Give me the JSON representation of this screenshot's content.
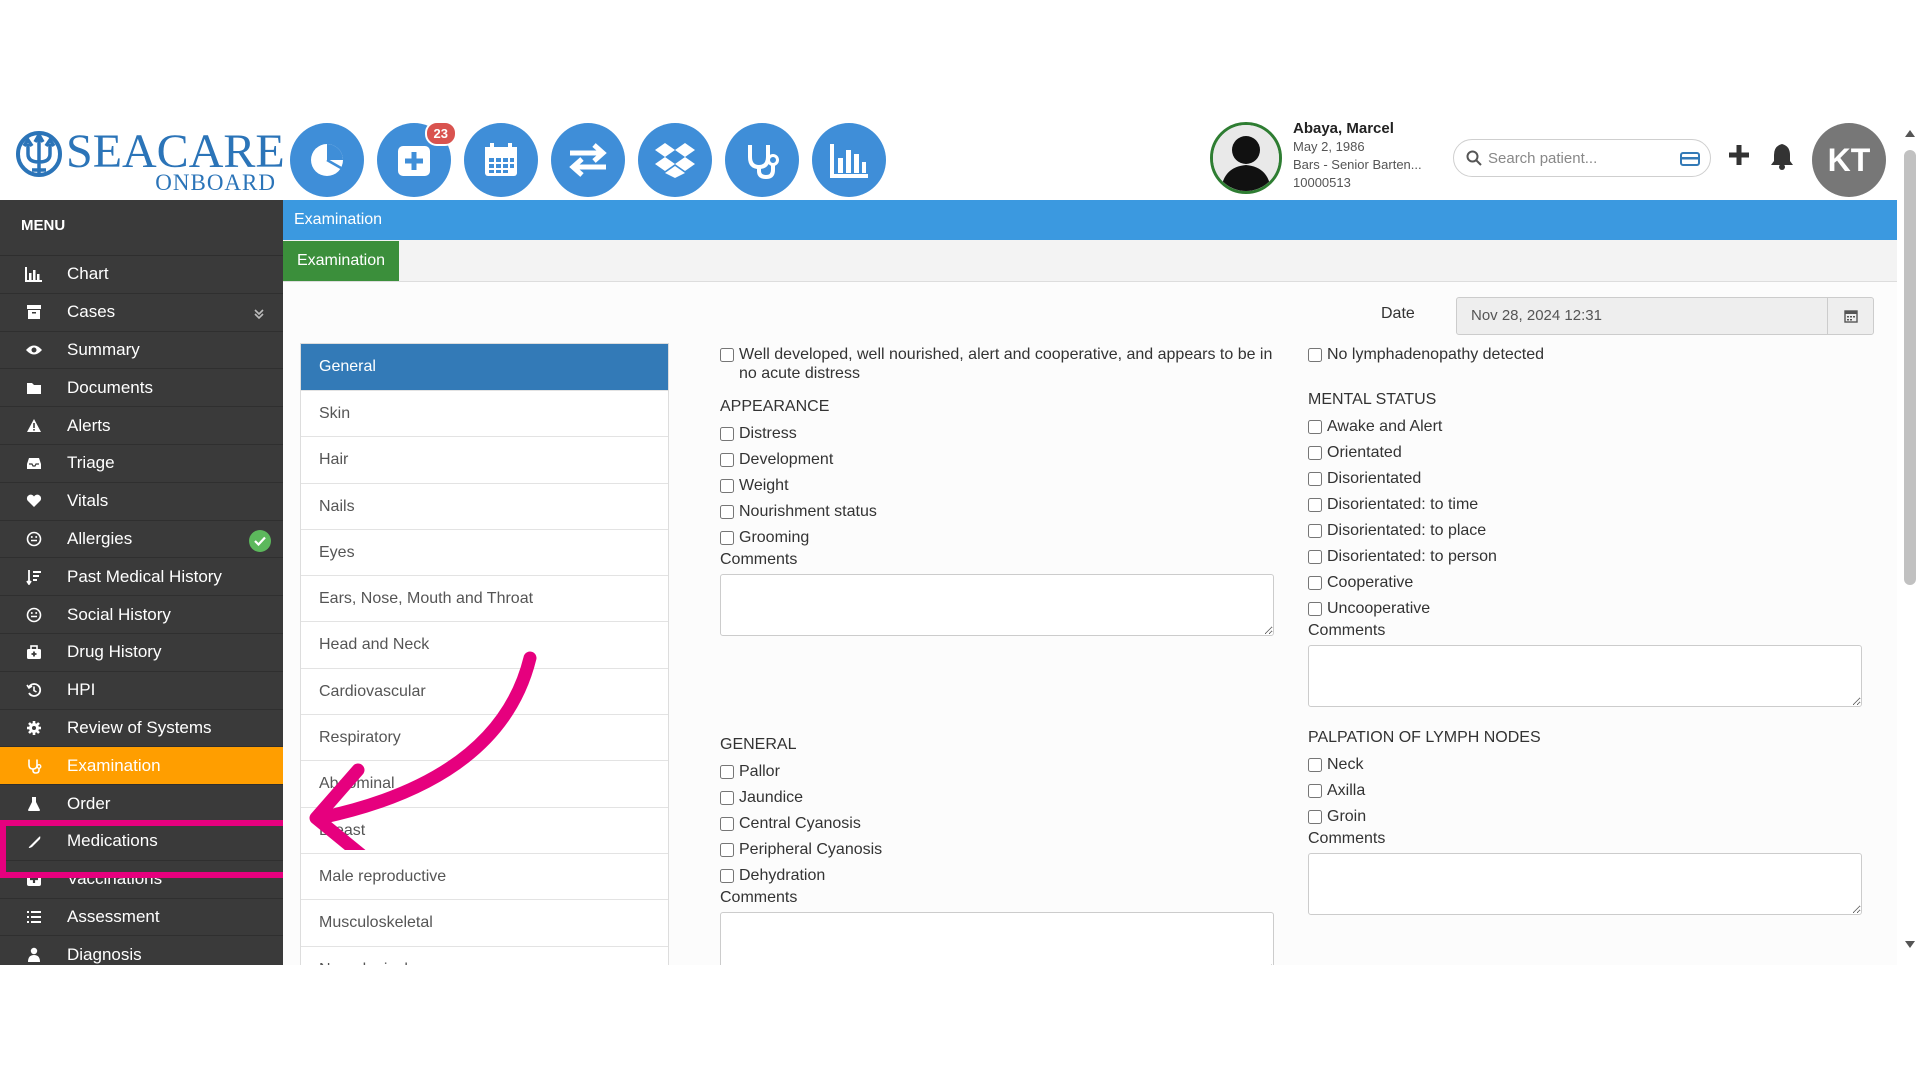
{
  "brand": {
    "name": "SEACARE",
    "sub": "ONBOARD",
    "color": "#2b74b8"
  },
  "toolbar": {
    "icons": [
      "dashboard-icon",
      "add-case-icon",
      "calendar-icon",
      "transfer-icon",
      "dropbox-icon",
      "stethoscope-icon",
      "bar-chart-icon"
    ],
    "add_case_badge": "23",
    "accent": "#3f8ed8"
  },
  "patient": {
    "name": "Abaya, Marcel",
    "dob": "May 2, 1986",
    "position": "Bars - Senior Barten...",
    "id": "10000513"
  },
  "search": {
    "placeholder": "Search patient..."
  },
  "user": {
    "initials": "KT"
  },
  "sidebar": {
    "menu_label": "MENU",
    "items": [
      {
        "label": "Chart",
        "icon": "bar-chart-icon"
      },
      {
        "label": "Cases",
        "icon": "archive-icon"
      },
      {
        "label": "Summary",
        "icon": "eye-icon"
      },
      {
        "label": "Documents",
        "icon": "folder-icon"
      },
      {
        "label": "Alerts",
        "icon": "warning-icon"
      },
      {
        "label": "Triage",
        "icon": "inbox-icon"
      },
      {
        "label": "Vitals",
        "icon": "heart-icon"
      },
      {
        "label": "Allergies",
        "icon": "face-icon"
      },
      {
        "label": "Past Medical History",
        "icon": "sort-icon"
      },
      {
        "label": "Social History",
        "icon": "face-icon"
      },
      {
        "label": "Drug History",
        "icon": "medkit-icon"
      },
      {
        "label": "HPI",
        "icon": "history-icon"
      },
      {
        "label": "Review of Systems",
        "icon": "gear-icon"
      },
      {
        "label": "Examination",
        "icon": "stethoscope-icon"
      },
      {
        "label": "Order",
        "icon": "flask-icon"
      },
      {
        "label": "Medications",
        "icon": "pill-icon"
      },
      {
        "label": "Vaccinations",
        "icon": "plus-square-icon"
      },
      {
        "label": "Assessment",
        "icon": "list-icon"
      },
      {
        "label": "Diagnosis",
        "icon": "doctor-icon"
      }
    ],
    "active": "Examination",
    "active_color": "#ff9e00"
  },
  "main": {
    "title": "Examination",
    "subtab": "Examination",
    "date_label": "Date",
    "date_value": "Nov 28, 2024 12:31",
    "sections": [
      "General",
      "Skin",
      "Hair",
      "Nails",
      "Eyes",
      "Ears, Nose, Mouth and Throat",
      "Head and Neck",
      "Cardiovascular",
      "Respiratory",
      "Abdominal",
      "Breast",
      "Male reproductive",
      "Musculoskeletal",
      "Neurological"
    ],
    "active_section": "General",
    "left": {
      "top_check": "Well developed, well nourished, alert and cooperative, and appears to be in no acute distress",
      "appearance_head": "APPEARANCE",
      "appearance": [
        "Distress",
        "Development",
        "Weight",
        "Nourishment status",
        "Grooming"
      ],
      "general_head": "GENERAL",
      "general": [
        "Pallor",
        "Jaundice",
        "Central Cyanosis",
        "Peripheral Cyanosis",
        "Dehydration"
      ],
      "comments_label": "Comments"
    },
    "right": {
      "top_check": "No lymphadenopathy detected",
      "mental_head": "MENTAL STATUS",
      "mental": [
        "Awake and Alert",
        "Orientated",
        "Disorientated",
        "Disorientated: to time",
        "Disorientated: to place",
        "Disorientated: to person",
        "Cooperative",
        "Uncooperative"
      ],
      "lymph_head": "PALPATION OF LYMPH NODES",
      "lymph": [
        "Neck",
        "Axilla",
        "Groin"
      ],
      "comments_label": "Comments"
    }
  },
  "annotation": {
    "color": "#e6007e"
  }
}
